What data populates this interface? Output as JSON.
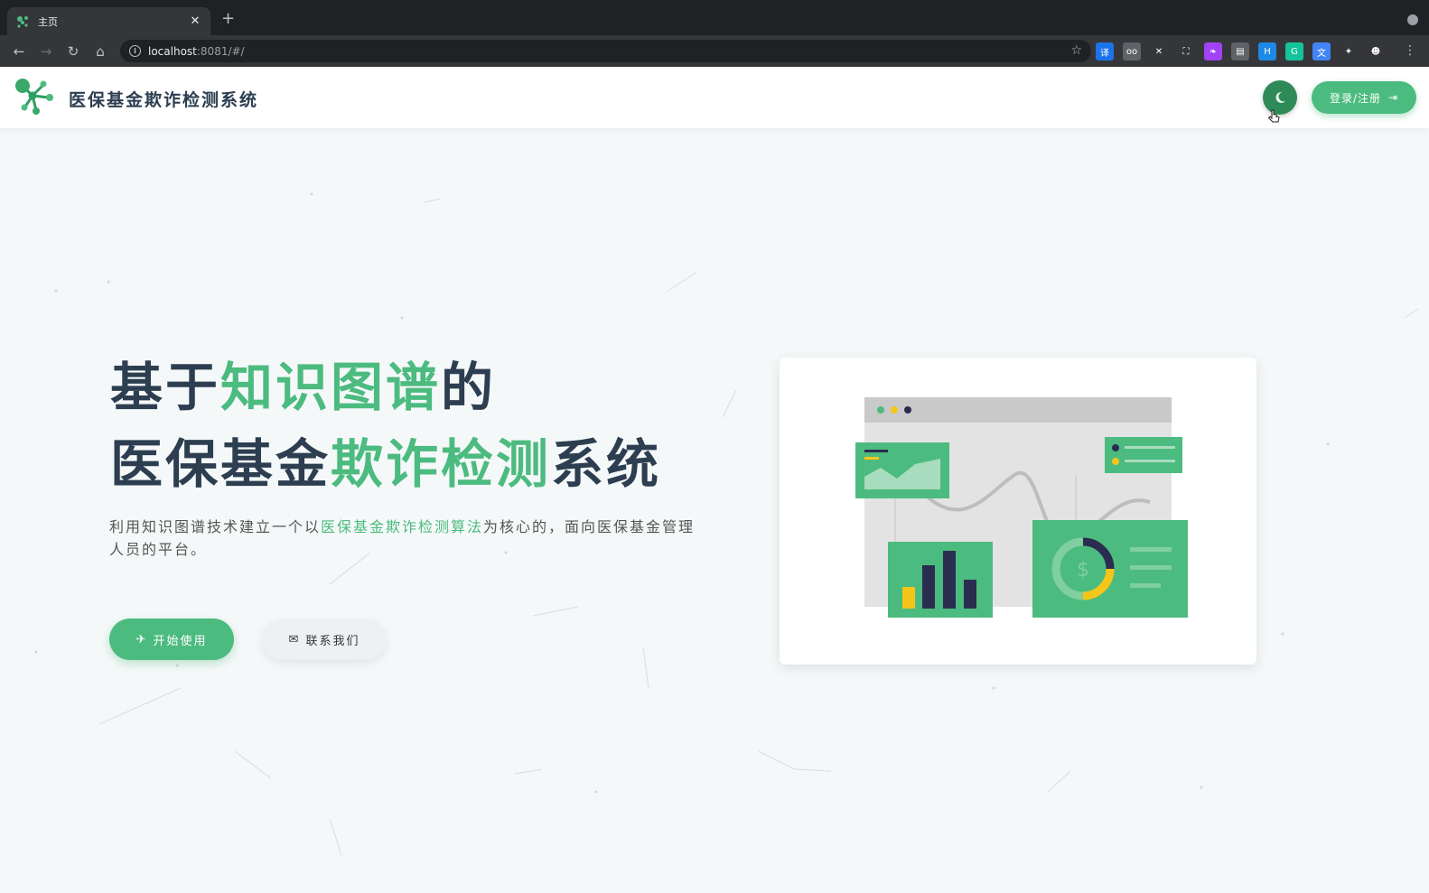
{
  "browser": {
    "tab_title": "主页",
    "tab_close": "✕",
    "new_tab": "+",
    "url_host": "localhost",
    "url_rest": ":8081/#/",
    "nav": {
      "back": "←",
      "forward": "→",
      "reload": "↻",
      "home": "⌂"
    },
    "star": "☆",
    "menu": "⋮",
    "extensions": [
      {
        "name": "translate-ext-icon",
        "label": "译",
        "color": "#1a73e8"
      },
      {
        "name": "oo-ext-icon",
        "label": "oo",
        "color": "#5f6368"
      },
      {
        "name": "x-ext-icon",
        "label": "✕",
        "color": "#35363a"
      },
      {
        "name": "bracket-ext-icon",
        "label": "⛶",
        "color": "#35363a"
      },
      {
        "name": "feather-ext-icon",
        "label": "❧",
        "color": "#a142f4"
      },
      {
        "name": "card-ext-icon",
        "label": "▤",
        "color": "#5f6368"
      },
      {
        "name": "h-ext-icon",
        "label": "H",
        "color": "#1e88e5"
      },
      {
        "name": "grammarly-ext-icon",
        "label": "G",
        "color": "#15c39a"
      },
      {
        "name": "translate2-ext-icon",
        "label": "文",
        "color": "#4285f4"
      },
      {
        "name": "puzzle-ext-icon",
        "label": "✦",
        "color": "#35363a"
      },
      {
        "name": "profile-ext-icon",
        "label": "☻",
        "color": "#35363a"
      }
    ]
  },
  "header": {
    "title": "医保基金欺诈检测系统",
    "login_label": "登录/注册",
    "login_icon": "⇥",
    "theme_icon": "☾"
  },
  "hero": {
    "line1": {
      "a": "基于",
      "b": "知识图谱",
      "c": "的"
    },
    "line2": {
      "a": "医保基金",
      "b": "欺诈检测",
      "c": "系统"
    },
    "desc": {
      "a": "利用知识图谱技术建立一个以",
      "b": "医保基金欺诈检测算法",
      "c": "为核心的，面向医保基金管理人员的平台。"
    },
    "start_label": "开始使用",
    "start_icon": "✈",
    "contact_label": "联系我们",
    "contact_icon": "✉"
  },
  "colors": {
    "accent": "#4cbb7f",
    "dark_text": "#2c3e50",
    "navy": "#2a2d4f",
    "yellow": "#f5c518"
  },
  "illustration": {
    "dollar": "$"
  }
}
